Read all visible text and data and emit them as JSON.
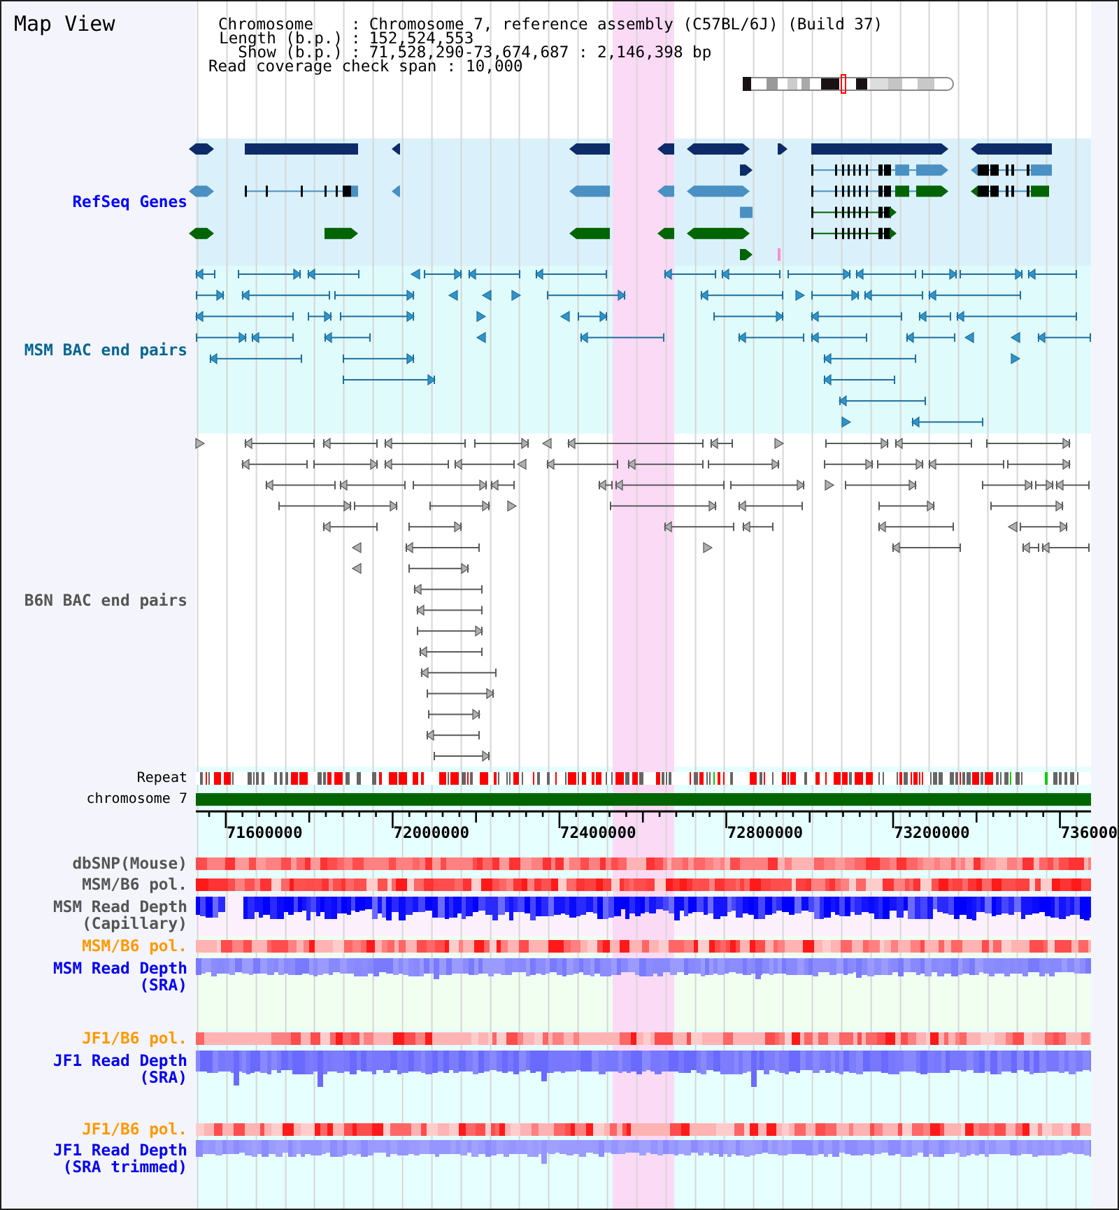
{
  "title": "Map View",
  "info": [
    {
      "label": "Chromosome",
      "separator": ":",
      "value": "Chromosome 7, reference assembly (C57BL/6J) (Build 37)"
    },
    {
      "label": "Length (b.p.)",
      "separator": ":",
      "value": "152,524,553"
    },
    {
      "label": "Show (b.p.)",
      "separator": ":",
      "value": "71,528,290-73,674,687 : 2,146,398 bp"
    }
  ],
  "coverage_check": {
    "label": "Read coverage check span",
    "separator": ":",
    "value": "10,000"
  },
  "tracks": [
    {
      "kind": "genes",
      "label": "RefSeq Genes",
      "color": "#0000ff"
    },
    {
      "kind": "bac_pairs",
      "label": "MSM BAC end pairs",
      "color": "#00668f"
    },
    {
      "kind": "bac_pairs",
      "label": "B6N BAC end pairs",
      "color": "#555555"
    },
    {
      "kind": "repeat",
      "label": "Repeat",
      "color": "#000000"
    },
    {
      "kind": "chromosome",
      "label": "chromosome 7",
      "color": "#000000"
    },
    {
      "kind": "ruler",
      "ticks": [
        "71600000",
        "72000000",
        "72400000",
        "72800000",
        "73200000",
        "736000"
      ]
    },
    {
      "kind": "snp",
      "label": "dbSNP(Mouse)",
      "color": "#555555"
    },
    {
      "kind": "polymorphism",
      "label": "MSM/B6 pol.",
      "color": "#555555"
    },
    {
      "kind": "depth",
      "label": "MSM Read Depth (Capillary)",
      "color": "#555555"
    },
    {
      "kind": "polymorphism",
      "label": "MSM/B6 pol.",
      "color": "#ff9900"
    },
    {
      "kind": "depth",
      "label": "MSM Read Depth (SRA)",
      "color": "#0000ee"
    },
    {
      "kind": "polymorphism",
      "label": "JF1/B6 pol.",
      "color": "#ff9900"
    },
    {
      "kind": "depth",
      "label": "JF1 Read Depth (SRA)",
      "color": "#0000ee"
    },
    {
      "kind": "polymorphism",
      "label": "JF1/B6 pol.",
      "color": "#ff9900"
    },
    {
      "kind": "depth",
      "label": "JF1 Read Depth (SRA trimmed)",
      "color": "#0000ee"
    }
  ]
}
